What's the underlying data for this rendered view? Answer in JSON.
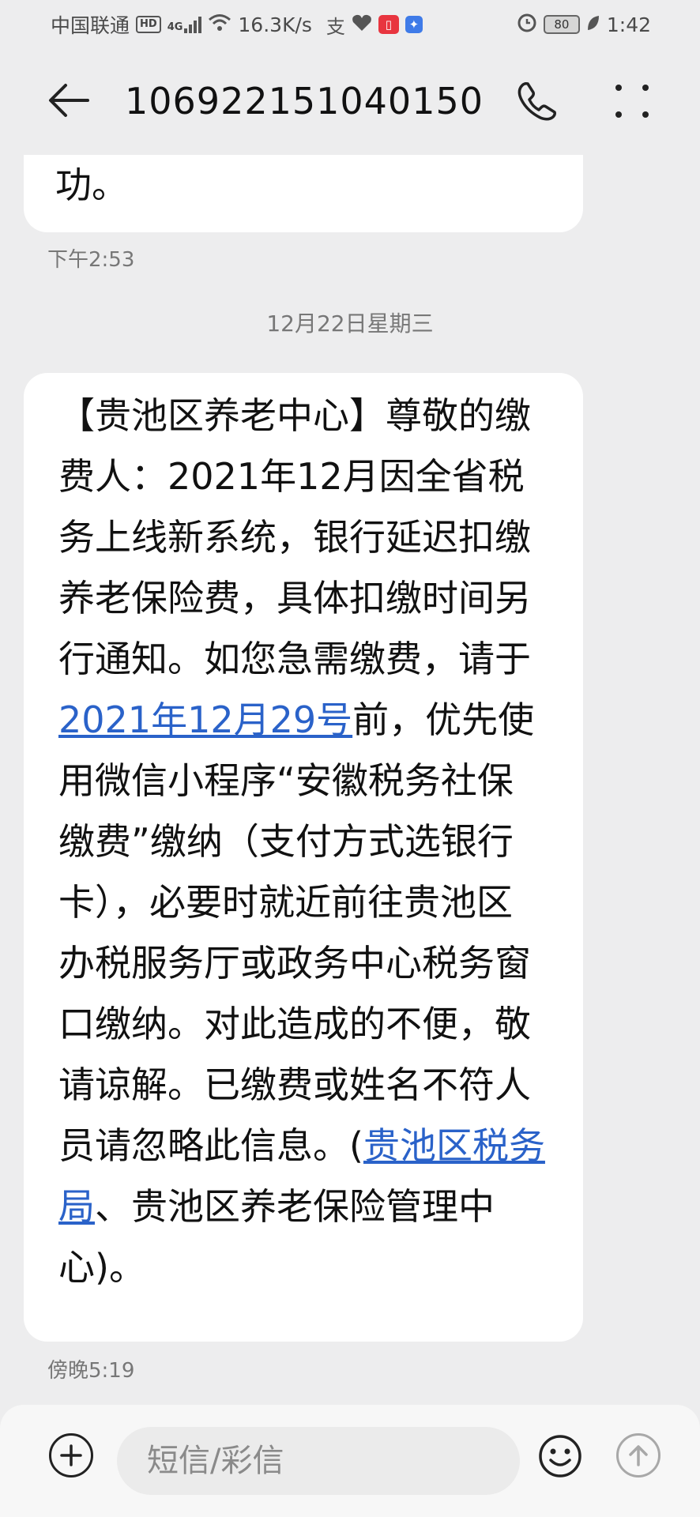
{
  "status_bar": {
    "carrier": "中国联通",
    "hd_badge": "HD",
    "network_type": "4G",
    "speed": "16.3K/s",
    "battery": "80",
    "time": "1:42",
    "icons": [
      "hd-icon",
      "signal-icon",
      "wifi-icon",
      "alipay-icon",
      "health-icon",
      "reader-app-icon",
      "baidu-icon",
      "alarm-icon",
      "battery-icon",
      "leaf-icon"
    ]
  },
  "header": {
    "title": "106922151040150",
    "icons": [
      "back-arrow-icon",
      "phone-icon",
      "more-icon"
    ]
  },
  "conversation": {
    "previous_message_tail": "功。",
    "previous_time": "下午2:53",
    "date_separator": "12月22日星期三",
    "message": {
      "part1": "【贵池区养老中心】尊敬的缴费人：2021年12月因全省税务上线新系统，银行延迟扣缴养老保险费，具体扣缴时间另行通知。如您急需缴费，请于",
      "link1": "2021年12月29号",
      "part2": "前，优先使用微信小程序“安徽税务社保缴费”缴纳（支付方式选银行卡），必要时就近前往贵池区办税服务厅或政务中心税务窗口缴纳。对此造成的不便，敬请谅解。已缴费或姓名不符人员请忽略此信息。(",
      "link2": "贵池区税务局",
      "part3": "、贵池区养老保险管理中心)。"
    },
    "message_time": "傍晚5:19"
  },
  "composer": {
    "placeholder": "短信/彩信",
    "value": "",
    "icons": [
      "add-icon",
      "emoji-icon",
      "send-icon"
    ]
  },
  "colors": {
    "background": "#ededee",
    "bubble": "#ffffff",
    "link": "#2a62c9",
    "battery_badge_red": "#e8353f"
  }
}
